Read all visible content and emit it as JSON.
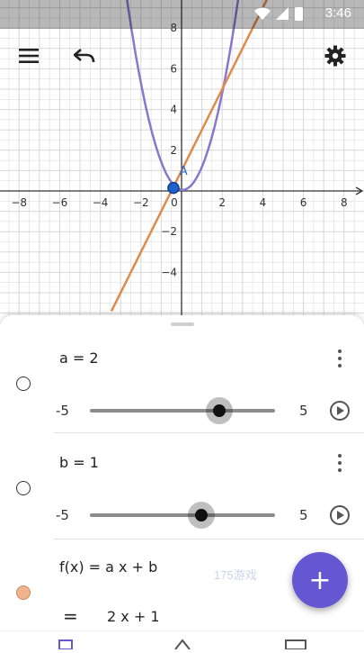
{
  "status": {
    "time": "3:46"
  },
  "graph": {
    "x_ticks": [
      "−8",
      "−6",
      "−4",
      "−2",
      "0",
      "2",
      "4",
      "6",
      "8"
    ],
    "y_ticks": [
      "8",
      "6",
      "4",
      "2",
      "−2",
      "−4"
    ],
    "point_label": "A",
    "colors": {
      "parabola": "#8878cc",
      "line": "#e08a4a",
      "point": "#1f63c9",
      "axis": "#333333",
      "grid": "#d7d7d7"
    }
  },
  "toolbar": {
    "menu_icon": "menu-icon",
    "undo_icon": "undo-icon",
    "settings_icon": "gear-icon"
  },
  "algebra": {
    "rows": [
      {
        "expr": "a = 2",
        "slider_min": "-5",
        "slider_max": "5",
        "value": 2,
        "min": -5,
        "max": 5
      },
      {
        "expr": "b = 1",
        "slider_min": "-5",
        "slider_max": "5",
        "value": 1,
        "min": -5,
        "max": 5
      },
      {
        "expr": "f(x) = a x + b",
        "result": "2 x + 1",
        "equals": "=",
        "color": "#f0b48c"
      }
    ]
  },
  "fab": {
    "label": "+"
  },
  "watermark": "175游戏"
}
